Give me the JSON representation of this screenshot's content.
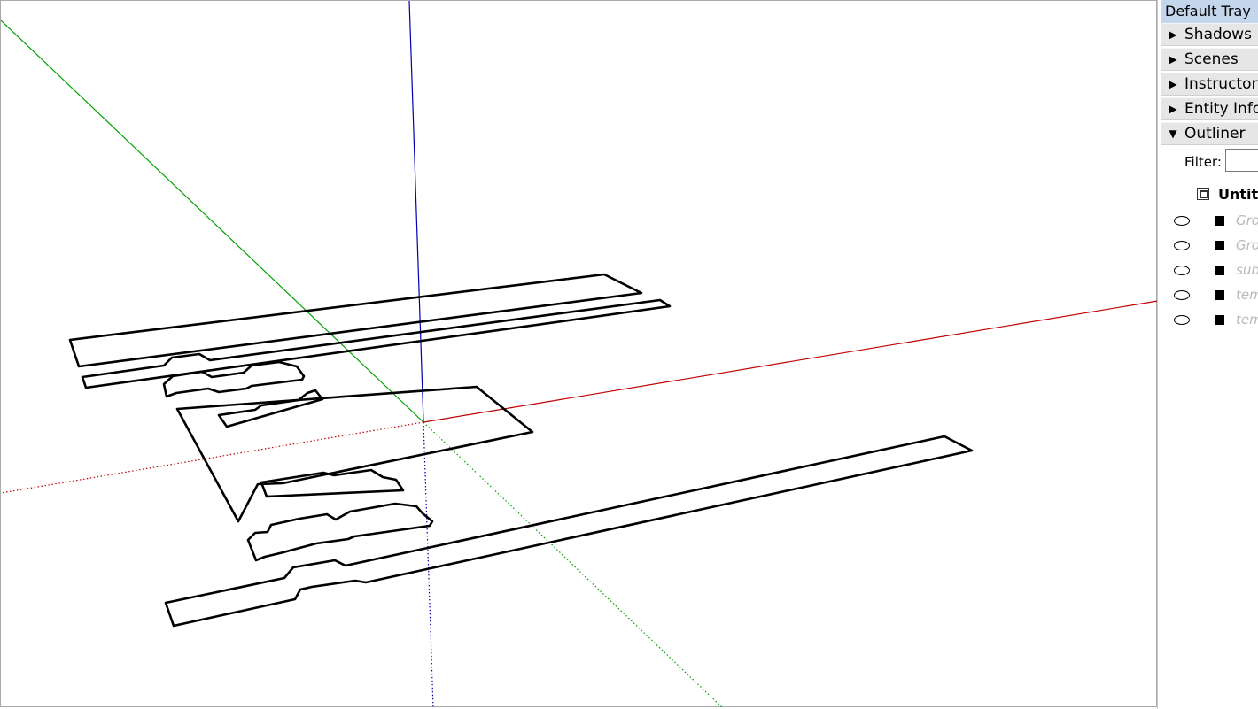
{
  "tray": {
    "title": "Default Tray",
    "panels": [
      {
        "label": "Shadows",
        "state": "collapsed"
      },
      {
        "label": "Scenes",
        "state": "collapsed"
      },
      {
        "label": "Instructor",
        "state": "collapsed"
      },
      {
        "label": "Entity Info",
        "state": "collapsed"
      },
      {
        "label": "Outliner",
        "state": "expanded"
      }
    ],
    "collapsed_glyph": "▶",
    "expanded_glyph": "▼"
  },
  "outliner": {
    "filter_label": "Filter:",
    "filter_value": "",
    "root_label": "Untitled",
    "rows": [
      {
        "label": "Group"
      },
      {
        "label": "Group"
      },
      {
        "label": "sub"
      },
      {
        "label": "tem"
      },
      {
        "label": "tem"
      }
    ]
  },
  "viewport": {
    "axis_colors": {
      "red": "#c00000",
      "green": "#00a000",
      "blue": "#0000b0"
    },
    "edge_color": "#000000",
    "icons": [
      "eye-icon",
      "component-square-icon",
      "home-icon",
      "arrow-cursor-icon"
    ]
  }
}
